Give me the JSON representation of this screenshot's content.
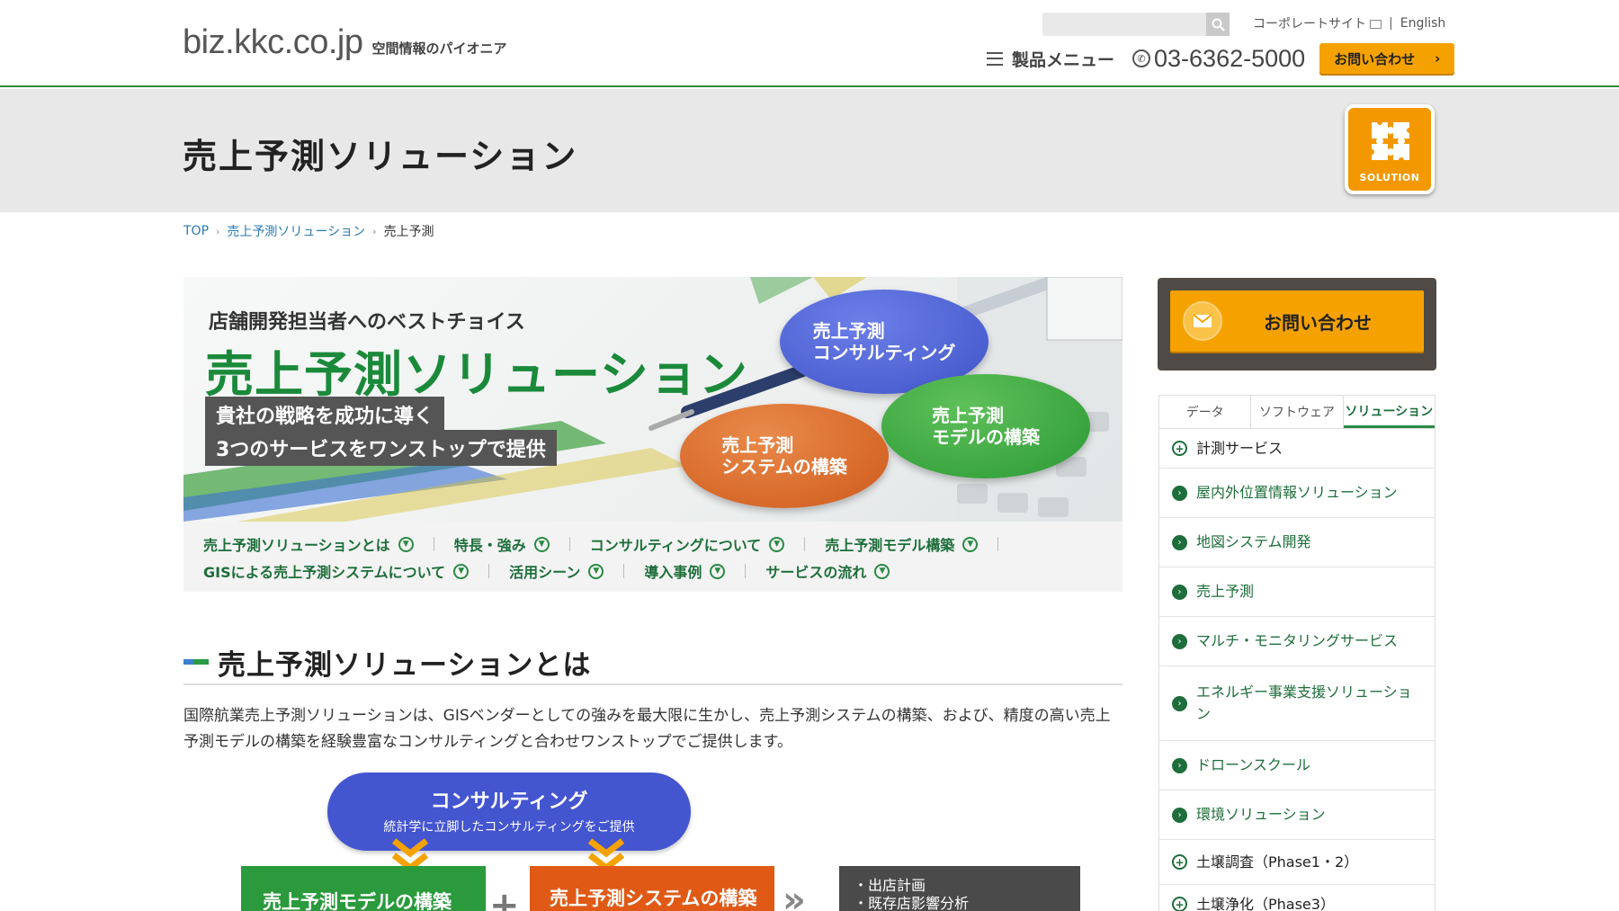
{
  "header": {
    "logo": "biz.kkc.co.jp",
    "tagline": "空間情報のパイオニア",
    "search_placeholder": "",
    "corporate_link": "コーポレートサイト",
    "separator": "|",
    "english_link": "English",
    "menu_label": "製品メニュー",
    "phone": "03-6362-5000",
    "contact_label": "お問い合わせ"
  },
  "title_band": {
    "title": "売上予測ソリューション",
    "badge_label": "SOLUTION"
  },
  "breadcrumb": {
    "items": [
      "TOP",
      "売上予測ソリューション",
      "売上予測"
    ]
  },
  "hero": {
    "subtitle": "店舗開発担当者へのベストチョイス",
    "title": "売上予測ソリューション",
    "tag1": "貴社の戦略を成功に導く",
    "tag2": "3つのサービスをワンストップで提供",
    "bubble_blue": "売上予測\nコンサルティング",
    "bubble_green": "売上予測\nモデルの構築",
    "bubble_orange": "売上予測\nシステムの構築"
  },
  "anchor_nav": {
    "row1": [
      "売上予測ソリューションとは",
      "特長・強み",
      "コンサルティングについて",
      "売上予測モデル構築"
    ],
    "row2": [
      "GISによる売上予測システムについて",
      "活用シーン",
      "導入事例",
      "サービスの流れ"
    ]
  },
  "section": {
    "title": "売上予測ソリューションとは",
    "text": "国際航業売上予測ソリューションは、GISベンダーとしての強みを最大限に生かし、売上予測システムの構築、および、精度の高い売上予測モデルの構築を経験豊富なコンサルティングと合わせワンストップでご提供します。"
  },
  "diagram": {
    "consult_title": "コンサルティング",
    "consult_sub": "統計学に立脚したコンサルティングをご提供",
    "green_box": "売上予測モデルの構築",
    "plus": "+",
    "orange_box": "売上予測システムの構築",
    "dark_line1": "・出店計画",
    "dark_line2": "・既存店影響分析"
  },
  "sidebar": {
    "contact_label": "お問い合わせ",
    "tabs": [
      "データ",
      "ソフトウェア",
      "ソリューション"
    ],
    "active_tab": "ソリューション",
    "items": [
      {
        "label": "計測サービス",
        "type": "plus"
      },
      {
        "label": "屋内外位置情報ソリューション",
        "type": "arrow"
      },
      {
        "label": "地図システム開発",
        "type": "arrow"
      },
      {
        "label": "売上予測",
        "type": "arrow"
      },
      {
        "label": "マルチ・モニタリングサービス",
        "type": "arrow"
      },
      {
        "label": "エネルギー事業支援ソリューション",
        "type": "arrow"
      },
      {
        "label": "ドローンスクール",
        "type": "arrow"
      },
      {
        "label": "環境ソリューション",
        "type": "arrow"
      },
      {
        "label": "土壌調査（Phase1・2）",
        "type": "plus"
      },
      {
        "label": "土壌浄化（Phase3）",
        "type": "plus"
      }
    ]
  },
  "colors": {
    "accent_green": "#2a8a44",
    "accent_orange": "#f5a200",
    "link_blue": "#2a7ab0"
  }
}
